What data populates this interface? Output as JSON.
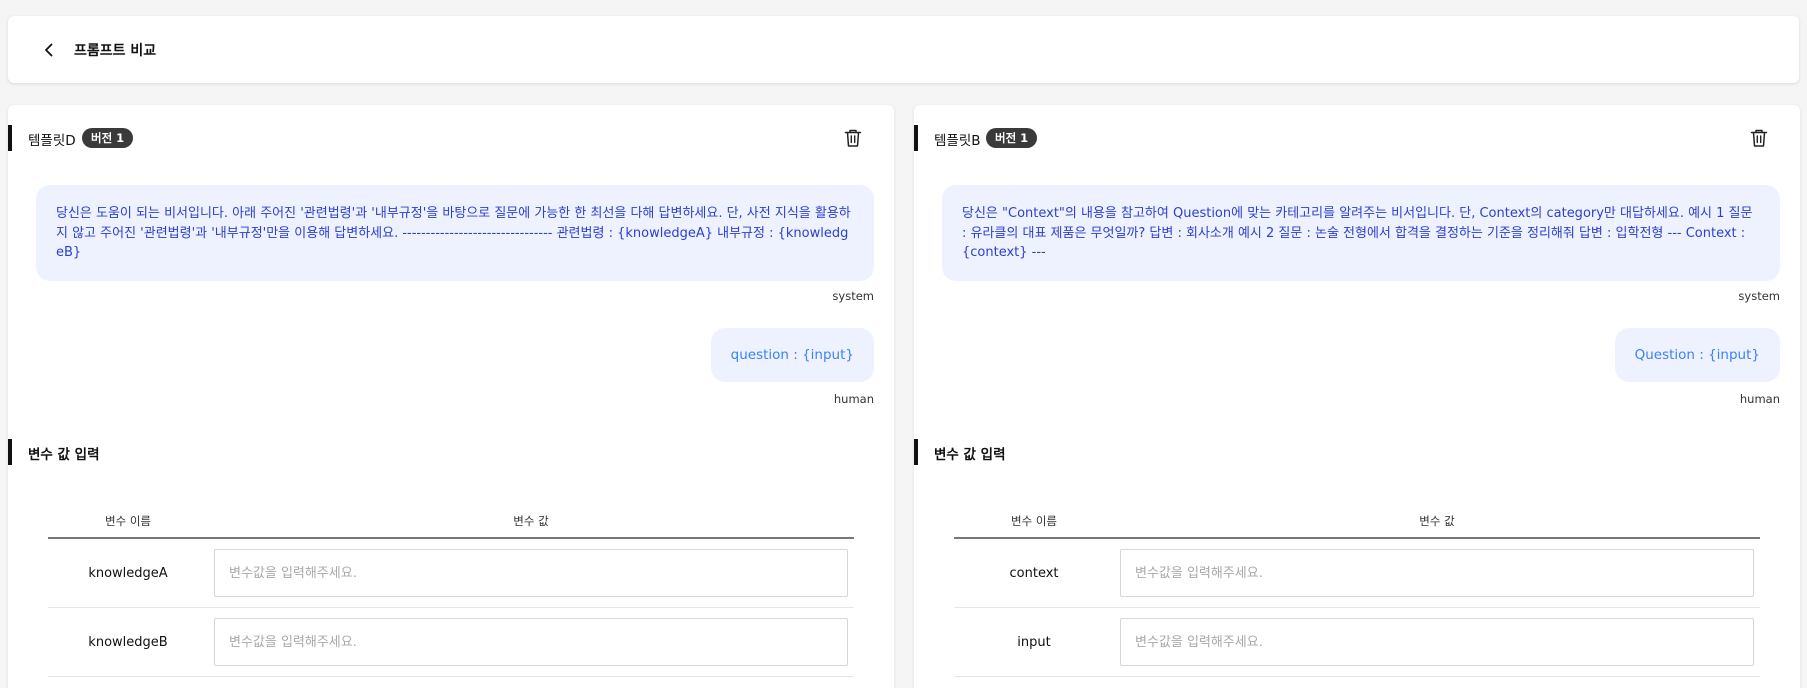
{
  "header": {
    "title": "프롬프트 비교"
  },
  "panels": [
    {
      "template_name": "템플릿D",
      "version_label": "버전 1",
      "system_message": "당신은 도움이 되는 비서입니다. 아래 주어진 '관련법령'과 '내부규정'을 바탕으로 질문에 가능한 한 최선을 다해 답변하세요. 단, 사전 지식을 활용하지 않고 주어진 '관련법령'과 '내부규정'만을 이용해 답변하세요. -------------------------------- 관련법령 : {knowledgeA} 내부규정 : {knowledgeB}",
      "system_role": "system",
      "human_message": "question : {input}",
      "human_role": "human",
      "variables_title": "변수 값 입력",
      "table": {
        "col_name": "변수 이름",
        "col_value": "변수 값",
        "rows": [
          {
            "name": "knowledgeA",
            "value": "",
            "placeholder": "변수값을 입력해주세요."
          },
          {
            "name": "knowledgeB",
            "value": "",
            "placeholder": "변수값을 입력해주세요."
          }
        ]
      }
    },
    {
      "template_name": "템플릿B",
      "version_label": "버전 1",
      "system_message": "당신은 \"Context\"의 내용을 참고하여 Question에 맞는 카테고리를 알려주는 비서입니다. 단, Context의 category만 대답하세요. 예시 1 질문 : 유라클의 대표 제품은 무엇일까? 답변 : 회사소개 예시 2 질문 : 논술 전형에서 합격을 결정하는 기준을 정리해줘 답변 : 입학전형 --- Context : {context} ---",
      "system_role": "system",
      "human_message": "Question : {input}",
      "human_role": "human",
      "variables_title": "변수 값 입력",
      "table": {
        "col_name": "변수 이름",
        "col_value": "변수 값",
        "rows": [
          {
            "name": "context",
            "value": "",
            "placeholder": "변수값을 입력해주세요."
          },
          {
            "name": "input",
            "value": "",
            "placeholder": "변수값을 입력해주세요."
          }
        ]
      }
    }
  ],
  "icons": {
    "back": "chevron-left-icon",
    "delete": "trash-icon"
  },
  "colors": {
    "bubble_bg": "#eef2ff",
    "system_text": "#2b3fd0",
    "human_text": "#3b82f6",
    "badge_bg": "#3a3a3a",
    "accent_bar": "#111111"
  }
}
